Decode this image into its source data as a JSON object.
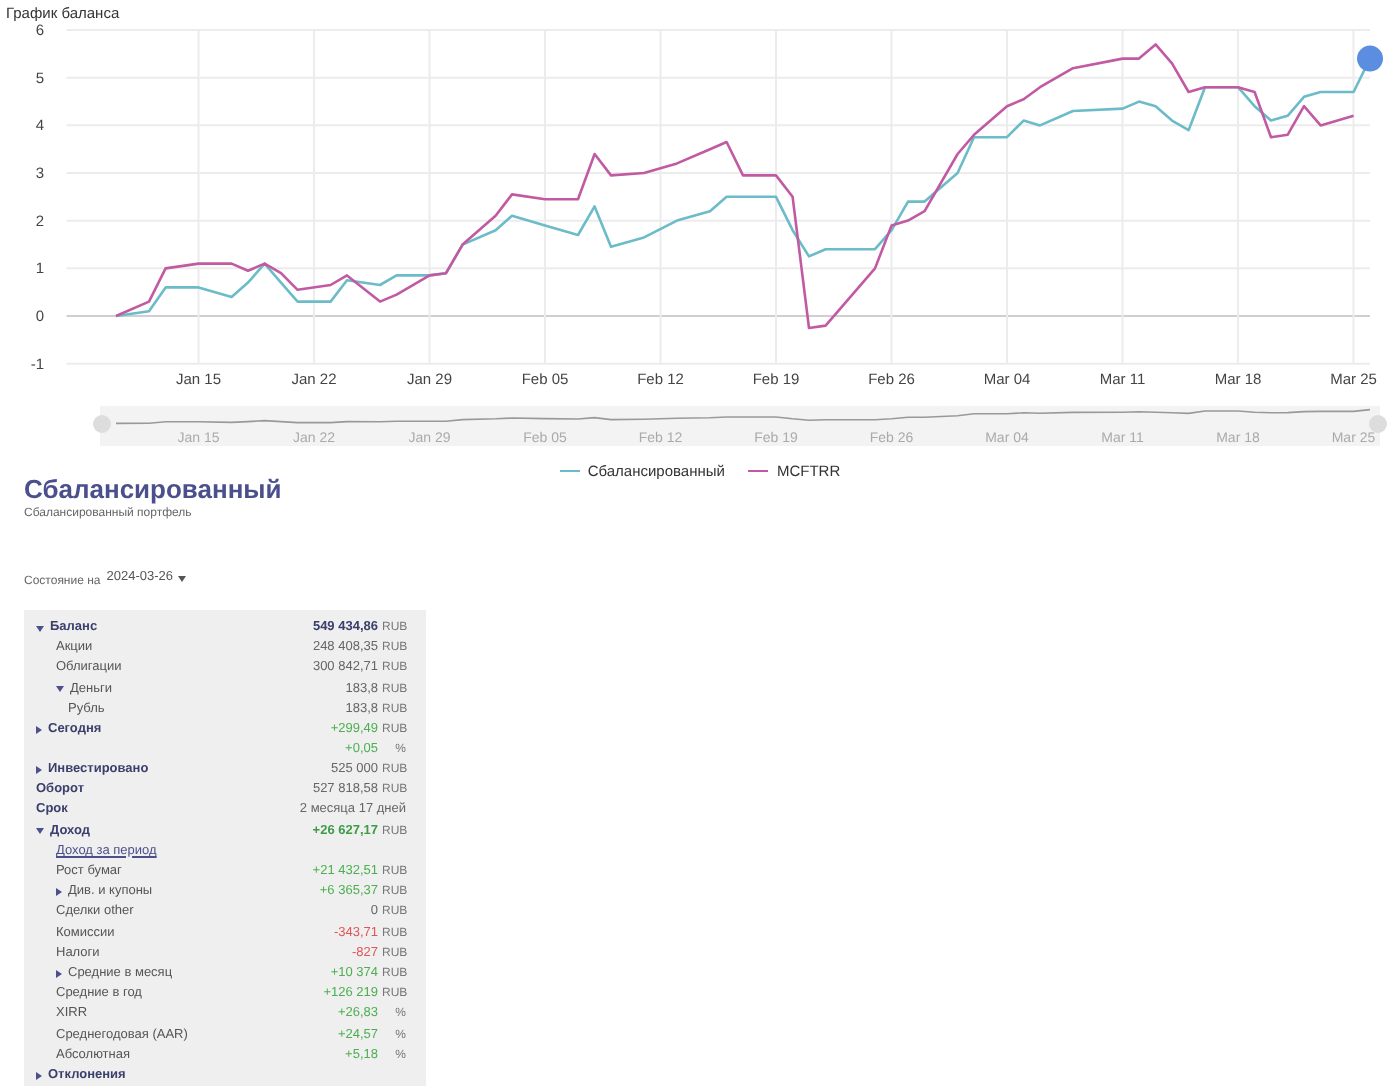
{
  "chart_title": "График баланса",
  "chart_data": {
    "type": "line",
    "x": [
      "2024-01-10",
      "2024-01-12",
      "2024-01-13",
      "2024-01-15",
      "2024-01-17",
      "2024-01-18",
      "2024-01-19",
      "2024-01-20",
      "2024-01-21",
      "2024-01-23",
      "2024-01-24",
      "2024-01-26",
      "2024-01-27",
      "2024-01-29",
      "2024-01-30",
      "2024-01-31",
      "2024-02-02",
      "2024-02-03",
      "2024-02-05",
      "2024-02-07",
      "2024-02-08",
      "2024-02-09",
      "2024-02-11",
      "2024-02-13",
      "2024-02-15",
      "2024-02-16",
      "2024-02-17",
      "2024-02-19",
      "2024-02-20",
      "2024-02-21",
      "2024-02-22",
      "2024-02-25",
      "2024-02-26",
      "2024-02-27",
      "2024-02-28",
      "2024-03-01",
      "2024-03-02",
      "2024-03-04",
      "2024-03-05",
      "2024-03-06",
      "2024-03-08",
      "2024-03-11",
      "2024-03-12",
      "2024-03-13",
      "2024-03-14",
      "2024-03-15",
      "2024-03-16",
      "2024-03-18",
      "2024-03-19",
      "2024-03-20",
      "2024-03-21",
      "2024-03-22",
      "2024-03-23",
      "2024-03-25",
      "2024-03-26"
    ],
    "series": [
      {
        "name": "Сбалансированный",
        "color": "#6bbcc8",
        "values": [
          0,
          0.1,
          0.6,
          0.6,
          0.4,
          0.7,
          1.1,
          0.7,
          0.3,
          0.3,
          0.75,
          0.65,
          0.85,
          0.85,
          0.9,
          1.5,
          1.8,
          2.1,
          1.9,
          1.7,
          2.3,
          1.45,
          1.65,
          2.0,
          2.2,
          2.5,
          2.5,
          2.5,
          1.8,
          1.25,
          1.4,
          1.4,
          1.8,
          2.4,
          2.4,
          3.0,
          3.75,
          3.75,
          4.1,
          4.0,
          4.3,
          4.35,
          4.5,
          4.4,
          4.1,
          3.9,
          4.8,
          4.8,
          4.4,
          4.1,
          4.2,
          4.6,
          4.7,
          4.7,
          5.4
        ]
      },
      {
        "name": "MCFTRR",
        "color": "#c15aa2",
        "values": [
          0,
          0.3,
          1.0,
          1.1,
          1.1,
          0.95,
          1.1,
          0.9,
          0.55,
          0.65,
          0.85,
          0.3,
          0.45,
          0.85,
          0.9,
          1.5,
          2.1,
          2.55,
          2.45,
          2.45,
          3.4,
          2.95,
          3.0,
          3.2,
          3.5,
          3.65,
          2.95,
          2.95,
          2.5,
          -0.25,
          -0.2,
          1.0,
          1.9,
          2.0,
          2.2,
          3.4,
          3.8,
          4.4,
          4.55,
          4.8,
          5.2,
          5.4,
          5.4,
          5.7,
          5.3,
          4.7,
          4.8,
          4.8,
          4.7,
          3.75,
          3.8,
          4.4,
          4.0,
          4.2,
          null
        ]
      }
    ],
    "xlim": [
      "2024-01-07",
      "2024-03-26"
    ],
    "grid": true,
    "ylim": [
      -1,
      6
    ],
    "yticks": [
      -1,
      0,
      1,
      2,
      3,
      4,
      5,
      6
    ],
    "xticks": [
      {
        "value": "2024-01-15",
        "label": "Jan 15"
      },
      {
        "value": "2024-01-22",
        "label": "Jan 22"
      },
      {
        "value": "2024-01-29",
        "label": "Jan 29"
      },
      {
        "value": "2024-02-05",
        "label": "Feb 05"
      },
      {
        "value": "2024-02-12",
        "label": "Feb 12"
      },
      {
        "value": "2024-02-19",
        "label": "Feb 19"
      },
      {
        "value": "2024-02-26",
        "label": "Feb 26"
      },
      {
        "value": "2024-03-04",
        "label": "Mar 04"
      },
      {
        "value": "2024-03-11",
        "label": "Mar 11"
      },
      {
        "value": "2024-03-18",
        "label": "Mar 18"
      },
      {
        "value": "2024-03-25",
        "label": "Mar 25"
      }
    ]
  },
  "navigator": {
    "labels": [
      "Jan 15",
      "Jan 22",
      "Jan 29",
      "Feb 05",
      "Feb 12",
      "Feb 19",
      "Feb 26",
      "Mar 04",
      "Mar 11",
      "Mar 18",
      "Mar 25"
    ]
  },
  "portfolio": {
    "title": "Сбалансированный",
    "subtitle": "Сбалансированный портфель"
  },
  "state": {
    "label": "Состояние на",
    "date": "2024-03-26"
  },
  "rows": [
    {
      "label": "Баланс",
      "bold": true,
      "expanded": true,
      "values": [
        {
          "text": "549 434,86",
          "unit": "RUB",
          "color": "#3a3f6b",
          "bold": true
        }
      ],
      "children": [
        {
          "label": "Акции",
          "bold": false,
          "values": [
            {
              "text": "248 408,35",
              "unit": "RUB",
              "color": "#666666",
              "bold": false
            }
          ]
        },
        {
          "label": "Облигации",
          "bold": false,
          "values": [
            {
              "text": "300 842,71",
              "unit": "RUB",
              "color": "#666666",
              "bold": false
            }
          ]
        },
        {
          "label": "Деньги",
          "bold": false,
          "expanded": true,
          "values": [
            {
              "text": "183,8",
              "unit": "RUB",
              "color": "#666666",
              "bold": false
            }
          ],
          "children": [
            {
              "label": "Рубль",
              "bold": false,
              "values": [
                {
                  "text": "183,8",
                  "unit": "RUB",
                  "color": "#666666",
                  "bold": false
                }
              ]
            }
          ]
        }
      ]
    },
    {
      "label": "Сегодня",
      "bold": true,
      "expanded": false,
      "values": [
        {
          "text": "+299,49",
          "unit": "RUB",
          "color": "#4caf50",
          "bold": false
        },
        {
          "text": "+0,05",
          "unit": "%",
          "color": "#4caf50",
          "bold": false
        }
      ]
    },
    {
      "label": "Инвестировано",
      "bold": true,
      "expanded": false,
      "values": [
        {
          "text": "525 000",
          "unit": "RUB",
          "color": "#666666",
          "bold": false
        }
      ]
    },
    {
      "label": "Оборот",
      "bold": true,
      "values": [
        {
          "text": "527 818,58",
          "unit": "RUB",
          "color": "#666666",
          "bold": false
        }
      ]
    },
    {
      "label": "Срок",
      "bold": true,
      "values": [
        {
          "text": "2 месяца 17 дней",
          "color": "#666666",
          "bold": false
        }
      ]
    },
    {
      "label": "Доход",
      "bold": true,
      "expanded": true,
      "values": [
        {
          "text": "+26 627,17",
          "unit": "RUB",
          "color": "#3d9c45",
          "bold": true
        }
      ],
      "children": [
        {
          "label": "Доход за период",
          "kind": "link"
        },
        {
          "label": "Рост бумаг",
          "bold": false,
          "values": [
            {
              "text": "+21 432,51",
              "unit": "RUB",
              "color": "#4caf50",
              "bold": false
            }
          ]
        },
        {
          "label": "Див. и купоны",
          "bold": false,
          "expanded": false,
          "values": [
            {
              "text": "+6 365,37",
              "unit": "RUB",
              "color": "#4caf50",
              "bold": false
            }
          ]
        },
        {
          "label": "Сделки other",
          "bold": false,
          "values": [
            {
              "text": "0",
              "unit": "RUB",
              "color": "#666666",
              "bold": false
            }
          ]
        },
        {
          "label": "Комиссии",
          "bold": false,
          "values": [
            {
              "text": "-343,71",
              "unit": "RUB",
              "color": "#e05555",
              "bold": false
            }
          ]
        },
        {
          "label": "Налоги",
          "bold": false,
          "values": [
            {
              "text": "-827",
              "unit": "RUB",
              "color": "#e05555",
              "bold": false
            }
          ]
        },
        {
          "label": "Средние в месяц",
          "bold": false,
          "expanded": false,
          "values": [
            {
              "text": "+10 374",
              "unit": "RUB",
              "color": "#4caf50",
              "bold": false
            }
          ]
        },
        {
          "label": "Средние в год",
          "bold": false,
          "values": [
            {
              "text": "+126 219",
              "unit": "RUB",
              "color": "#4caf50",
              "bold": false
            }
          ]
        },
        {
          "label": "XIRR",
          "bold": false,
          "values": [
            {
              "text": "+26,83",
              "unit": "%",
              "color": "#4caf50",
              "bold": false
            }
          ]
        },
        {
          "label": "Среднегодовая (AAR)",
          "bold": false,
          "values": [
            {
              "text": "+24,57",
              "unit": "%",
              "color": "#4caf50",
              "bold": false
            }
          ]
        },
        {
          "label": "Абсолютная",
          "bold": false,
          "values": [
            {
              "text": "+5,18",
              "unit": "%",
              "color": "#4caf50",
              "bold": false
            }
          ]
        }
      ]
    },
    {
      "label": "Отклонения",
      "bold": true,
      "expanded": false
    }
  ]
}
